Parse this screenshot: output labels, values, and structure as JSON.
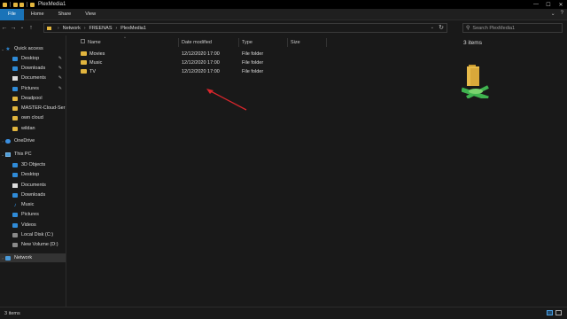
{
  "window": {
    "title": "PlexMedia1",
    "controls": {
      "minimize": "—",
      "maximize": "☐",
      "close": "✕"
    }
  },
  "ribbon": {
    "tabs": [
      "File",
      "Home",
      "Share",
      "View"
    ],
    "right_glyphs": {
      "expand": "⌄",
      "help": "?"
    }
  },
  "navigation": {
    "back": "←",
    "forward": "→",
    "recent": "⌄",
    "up": "↑",
    "breadcrumb": [
      "Network",
      "FREENAS",
      "PlexMedia1"
    ],
    "crumb_separator": "›",
    "refresh": "↻"
  },
  "search": {
    "placeholder": "Search PlexMedia1",
    "glyph": "⚲"
  },
  "sidebar": {
    "items": [
      {
        "label": "Quick access",
        "icon": "star-icon",
        "level": 0
      },
      {
        "label": "Desktop",
        "icon": "desktop-icon",
        "level": 1,
        "pinned": true
      },
      {
        "label": "Downloads",
        "icon": "downloads-icon",
        "level": 1,
        "pinned": true
      },
      {
        "label": "Documents",
        "icon": "documents-icon",
        "level": 1,
        "pinned": true
      },
      {
        "label": "Pictures",
        "icon": "pictures-icon",
        "level": 1,
        "pinned": true
      },
      {
        "label": "Deadpool",
        "icon": "folder-icon",
        "level": 1
      },
      {
        "label": "MASTER-Cloud-Ser",
        "icon": "folder-icon",
        "level": 1
      },
      {
        "label": "own cloud",
        "icon": "folder-icon",
        "level": 1
      },
      {
        "label": "wildan",
        "icon": "folder-icon",
        "level": 1
      },
      {
        "label": "OneDrive",
        "icon": "cloud-icon",
        "level": 0
      },
      {
        "label": "This PC",
        "icon": "pc-icon",
        "level": 0
      },
      {
        "label": "3D Objects",
        "icon": "objects-3d-icon",
        "level": 1
      },
      {
        "label": "Desktop",
        "icon": "desktop-icon",
        "level": 1
      },
      {
        "label": "Documents",
        "icon": "documents-icon",
        "level": 1
      },
      {
        "label": "Downloads",
        "icon": "downloads-icon",
        "level": 1
      },
      {
        "label": "Music",
        "icon": "music-icon",
        "level": 1
      },
      {
        "label": "Pictures",
        "icon": "pictures-icon",
        "level": 1
      },
      {
        "label": "Videos",
        "icon": "videos-icon",
        "level": 1
      },
      {
        "label": "Local Disk (C:)",
        "icon": "drive-icon",
        "level": 1
      },
      {
        "label": "New Volume (D:)",
        "icon": "drive-icon",
        "level": 1
      },
      {
        "label": "Network",
        "icon": "network-icon",
        "level": 0,
        "selected": true
      }
    ],
    "pin_glyph": "✎",
    "chevron_glyph": "›"
  },
  "file_list": {
    "columns": [
      "Name",
      "Date modified",
      "Type",
      "Size"
    ],
    "sort_glyph": "^",
    "rows": [
      {
        "name": "Movies",
        "date": "12/12/2020 17:00",
        "type": "File folder",
        "size": ""
      },
      {
        "name": "Music",
        "date": "12/12/2020 17:00",
        "type": "File folder",
        "size": ""
      },
      {
        "name": "TV",
        "date": "12/12/2020 17:00",
        "type": "File folder",
        "size": ""
      }
    ]
  },
  "details": {
    "count": "3 items"
  },
  "status": {
    "count": "3 items"
  },
  "colors": {
    "background": "#191919",
    "file_tab": "#1a73b8",
    "folder": "#e2b53e",
    "annotation_arrow": "#d9262c"
  }
}
